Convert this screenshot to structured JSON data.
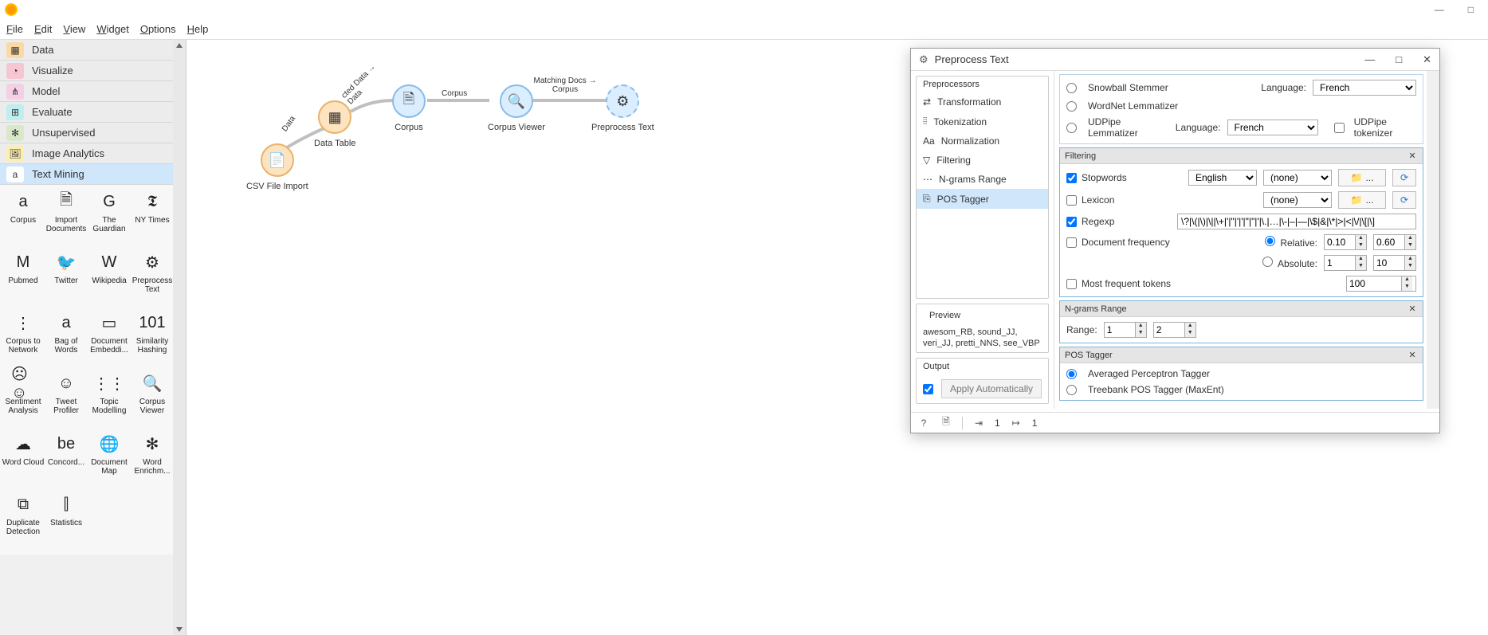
{
  "app": {
    "minimize": "—",
    "maximize": "□",
    "close": "×"
  },
  "menu": {
    "file": "File",
    "edit": "Edit",
    "view": "View",
    "widget": "Widget",
    "options": "Options",
    "help": "Help"
  },
  "categories": {
    "data": "Data",
    "visualize": "Visualize",
    "model": "Model",
    "evaluate": "Evaluate",
    "unsupervised": "Unsupervised",
    "image": "Image Analytics",
    "text": "Text Mining"
  },
  "widgets": [
    {
      "label": "Corpus"
    },
    {
      "label": "Import Documents"
    },
    {
      "label": "The Guardian"
    },
    {
      "label": "NY Times"
    },
    {
      "label": "Pubmed"
    },
    {
      "label": "Twitter"
    },
    {
      "label": "Wikipedia"
    },
    {
      "label": "Preprocess Text"
    },
    {
      "label": "Corpus to Network"
    },
    {
      "label": "Bag of Words"
    },
    {
      "label": "Document Embeddi..."
    },
    {
      "label": "Similarity Hashing"
    },
    {
      "label": "Sentiment Analysis"
    },
    {
      "label": "Tweet Profiler"
    },
    {
      "label": "Topic Modelling"
    },
    {
      "label": "Corpus Viewer"
    },
    {
      "label": "Word Cloud"
    },
    {
      "label": "Concord..."
    },
    {
      "label": "Document Map"
    },
    {
      "label": "Word Enrichm..."
    },
    {
      "label": "Duplicate Detection"
    },
    {
      "label": "Statistics"
    }
  ],
  "canvas": {
    "nodes": {
      "csv": "CSV File Import",
      "datatable": "Data Table",
      "corpus": "Corpus",
      "viewer": "Corpus Viewer",
      "preprocess": "Preprocess Text"
    },
    "edges": {
      "e1": "Data",
      "e2": "cted Data → Data",
      "e3": "Corpus",
      "e4": "Matching Docs → Corpus"
    }
  },
  "dialog": {
    "title": "Preprocess Text",
    "preprocessors_head": "Preprocessors",
    "list": {
      "transformation": "Transformation",
      "tokenization": "Tokenization",
      "normalization": "Normalization",
      "filtering": "Filtering",
      "ngrams": "N-grams Range",
      "pos": "POS Tagger"
    },
    "preview_head": "Preview",
    "preview_body": "awesom_RB, sound_JJ, veri_JJ, pretti_NNS, see_VBP",
    "output_head": "Output",
    "apply": "Apply Automatically",
    "norm": {
      "snowball": "Snowball Stemmer",
      "wordnet": "WordNet Lemmatizer",
      "udpipe": "UDPipe Lemmatizer",
      "language": "Language:",
      "lang1": "French",
      "lang2": "French",
      "udtoken": "UDPipe tokenizer"
    },
    "filtering": {
      "head": "Filtering",
      "stopwords": "Stopwords",
      "stop_lang": "English",
      "stop_file": "(none)",
      "lexicon": "Lexicon",
      "lex_file": "(none)",
      "regexp": "Regexp",
      "regexp_value": "\\?|\\(|\\)|\\||\\+|'|\"|'|'|\"|\"|'|\\.|…|\\-|–|—|\\$|&|\\*|>|<|\\/|\\[|\\]",
      "docfreq": "Document frequency",
      "relative": "Relative:",
      "absolute": "Absolute:",
      "rel_min": "0.10",
      "rel_max": "0.60",
      "abs_min": "1",
      "abs_max": "10",
      "mostfreq": "Most frequent tokens",
      "mostfreq_val": "100",
      "dots": "..."
    },
    "ngrams": {
      "head": "N-grams Range",
      "range": "Range:",
      "min": "1",
      "max": "2"
    },
    "pos": {
      "head": "POS Tagger",
      "avg": "Averaged Perceptron Tagger",
      "treebank": "Treebank POS Tagger (MaxEnt)"
    },
    "status": {
      "in": "1",
      "out": "1"
    }
  }
}
